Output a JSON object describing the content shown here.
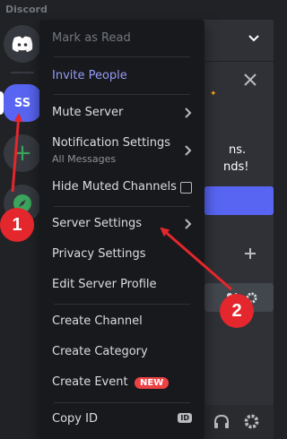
{
  "app_title": "Discord",
  "rail": {
    "server_initials": "SS",
    "add_glyph": "+"
  },
  "menu": {
    "items": [
      {
        "label": "Mark as Read"
      },
      {
        "label": "Invite People"
      },
      {
        "label": "Mute Server"
      },
      {
        "label": "Notification Settings",
        "sub": "All Messages"
      },
      {
        "label": "Hide Muted Channels"
      },
      {
        "label": "Server Settings"
      },
      {
        "label": "Privacy Settings"
      },
      {
        "label": "Edit Server Profile"
      },
      {
        "label": "Create Channel"
      },
      {
        "label": "Create Category"
      },
      {
        "label": "Create Event",
        "badge": "NEW"
      },
      {
        "label": "Copy ID",
        "badge": "ID"
      }
    ]
  },
  "background": {
    "promo_line1": "ns.",
    "promo_line2": "nds!"
  },
  "annotations": [
    {
      "number": "1"
    },
    {
      "number": "2"
    }
  ],
  "colors": {
    "accent": "#5865f2",
    "annotation_red": "#e3272c",
    "menu_bg": "#18191c"
  }
}
